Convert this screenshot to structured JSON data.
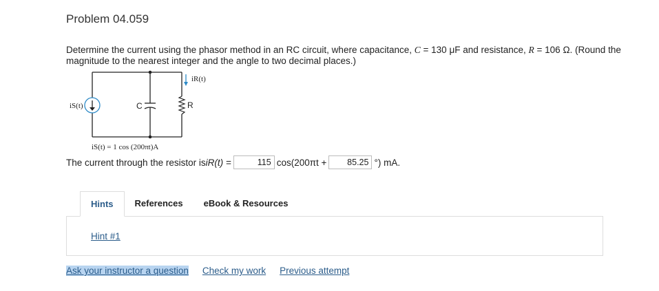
{
  "title": "Problem 04.059",
  "problem_text": {
    "line1_a": "Determine the current using the phasor method in an RC circuit, where capacitance, ",
    "c_var": "C",
    "c_eq": " = 130 μF and resistance, ",
    "r_var": "R",
    "r_eq": " = 106 Ω. (Round the",
    "line2": "magnitude to the nearest integer and the angle to two decimal places.)"
  },
  "circuit": {
    "source_label": "iS(t)",
    "cap_label": "C",
    "res_label": "R",
    "current_label": "iR(t)",
    "caption": "iS(t) = 1 cos (200πt)A"
  },
  "answer": {
    "prefix": "The current through the resistor is ",
    "func": "iR(t) =",
    "magnitude": "115",
    "middle": "cos(200πt +",
    "angle": "85.25",
    "suffix": "°) mA."
  },
  "tabs": [
    {
      "label": "Hints"
    },
    {
      "label": "References"
    },
    {
      "label": "eBook & Resources"
    }
  ],
  "hint_link": "Hint #1",
  "footer": {
    "ask": "Ask your instructor a question",
    "check": "Check my work",
    "previous": "Previous attempt"
  },
  "colors": {
    "link": "#2b5c8a",
    "highlight": "#b8d4f0",
    "arrow": "#2d8ac7"
  }
}
